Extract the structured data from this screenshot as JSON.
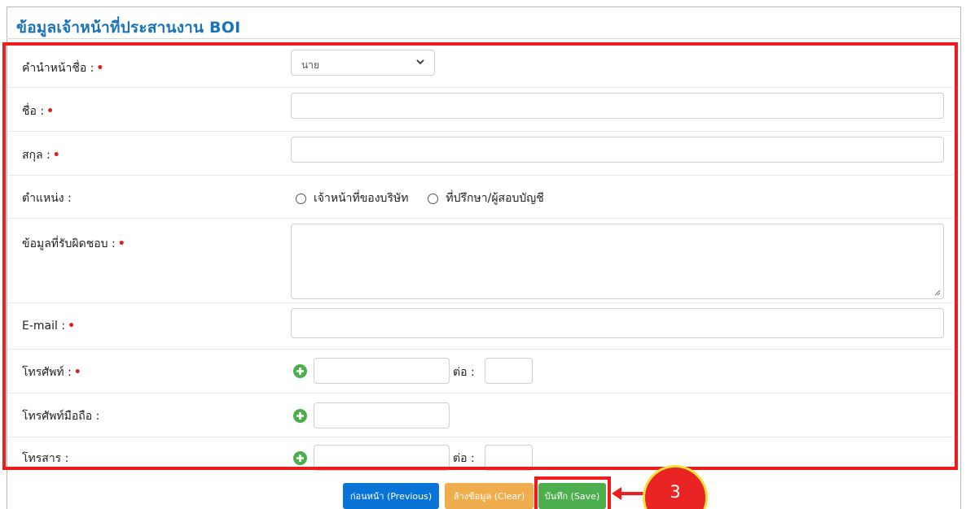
{
  "panel": {
    "title": "ข้อมูลเจ้าหน้าที่ประสานงาน BOI"
  },
  "required_mark": "•",
  "fields": {
    "prefix": {
      "label": "คำนำหน้าชื่อ :",
      "selected": "นาย",
      "required": true
    },
    "first_name": {
      "label": "ชื่อ :",
      "value": "",
      "required": true
    },
    "last_name": {
      "label": "สกุล :",
      "value": "",
      "required": true
    },
    "position": {
      "label": "ตำแหน่ง :",
      "options": [
        "เจ้าหน้าที่ของบริษัท",
        "ที่ปรึกษา/ผู้สอบบัญชี"
      ]
    },
    "responsibility": {
      "label": "ข้อมูลที่รับผิดชอบ :",
      "value": "",
      "required": true
    },
    "email": {
      "label": "E-mail :",
      "value": "",
      "required": true
    },
    "phone": {
      "label": "โทรศัพท์ :",
      "value": "",
      "ext_label": "ต่อ :",
      "ext_value": "",
      "required": true
    },
    "mobile": {
      "label": "โทรศัพท์มือถือ :",
      "value": ""
    },
    "fax": {
      "label": "โทรสาร :",
      "value": "",
      "ext_label": "ต่อ :",
      "ext_value": ""
    }
  },
  "buttons": {
    "previous": "ก่อนหน้า (Previous)",
    "clear": "ล้างข้อมูล (Clear)",
    "save": "บันทึก (Save)"
  },
  "annotation": {
    "step_number": "3"
  },
  "colors": {
    "title": "#1a73b8",
    "highlight": "#ee1c1c",
    "add_icon": "#4cae4c",
    "btn_previous": "#0a74d6",
    "btn_clear": "#f0ad4e",
    "btn_save": "#4cae4c",
    "callout_fill": "#ea2424",
    "callout_ring": "#f2e23a"
  },
  "icons": {
    "select_caret": "chevron-down-icon",
    "add_phone": "plus-circle-icon",
    "resize": "resize-grip-icon"
  }
}
